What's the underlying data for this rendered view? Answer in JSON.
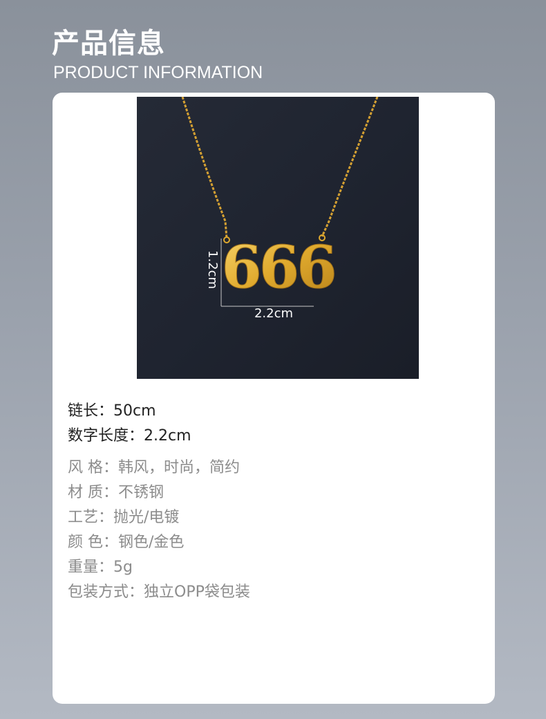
{
  "header": {
    "title_cn": "产品信息",
    "title_en": "PRODUCT INFORMATION"
  },
  "photo": {
    "pendant_text": "666",
    "height_label": "1.2cm",
    "width_label": "2.2cm"
  },
  "specs_main": [
    "链长：50cm",
    "数字长度：2.2cm"
  ],
  "specs_detail": [
    "风 格：韩风，时尚，简约",
    "材 质：不锈钢",
    "工艺：抛光/电镀",
    "颜 色：钢色/金色",
    "重量：5g",
    "包装方式：独立OPP袋包装"
  ]
}
